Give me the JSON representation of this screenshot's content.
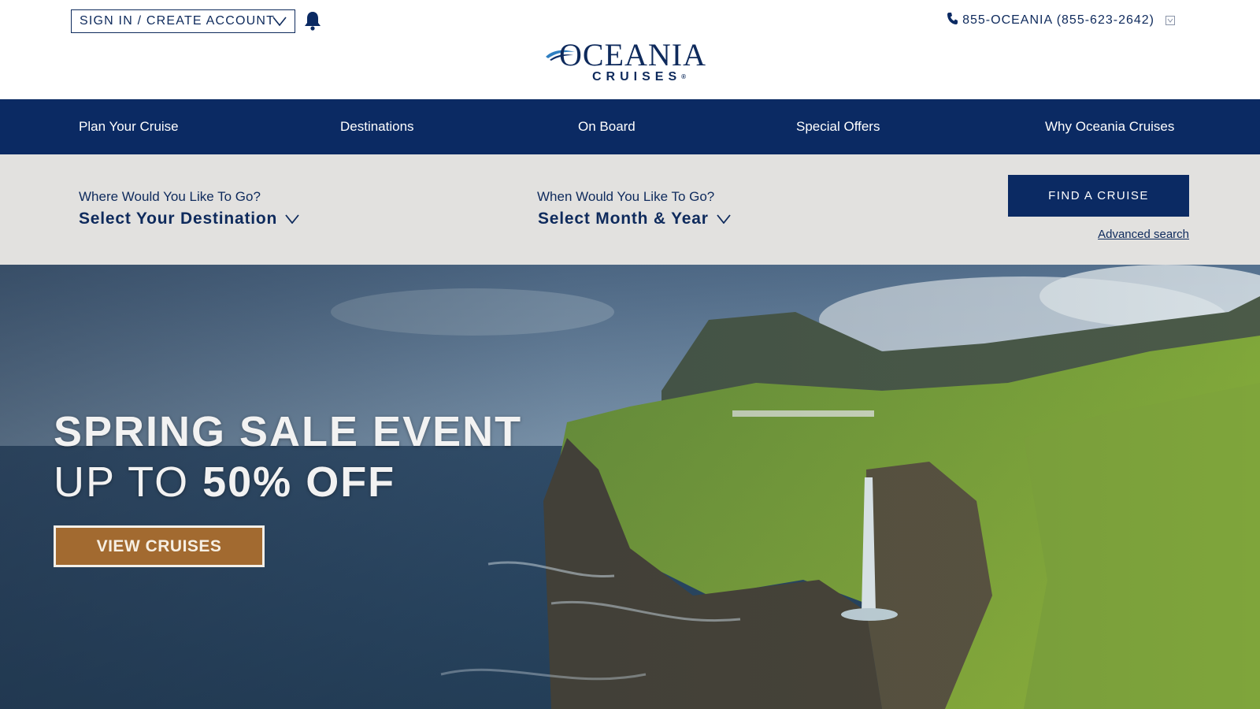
{
  "header": {
    "signin_label": "SIGN IN / CREATE ACCOUNT",
    "phone_label": "855-OCEANIA (855-623-2642)",
    "logo": {
      "name": "OCEANIA",
      "sub": "CRUISES",
      "mark": "®"
    }
  },
  "nav": {
    "items": [
      {
        "label": "Plan Your Cruise"
      },
      {
        "label": "Destinations"
      },
      {
        "label": "On Board"
      },
      {
        "label": "Special Offers"
      },
      {
        "label": "Why Oceania Cruises"
      }
    ]
  },
  "search": {
    "destination_label": "Where Would You Like To Go?",
    "destination_value": "Select Your Destination",
    "date_label": "When Would You Like To Go?",
    "date_value": "Select Month & Year",
    "find_button": "FIND A CRUISE",
    "advanced_link": "Advanced search"
  },
  "hero": {
    "line1": "SPRING SALE EVENT",
    "line2_prefix": "UP TO",
    "line2_bold": "50% OFF",
    "cta": "VIEW CRUISES"
  },
  "colors": {
    "brand_navy": "#0b2a63",
    "search_bg": "#e2e1df",
    "cta_bronze": "#a26a30"
  },
  "icons": [
    "chevron-down-icon",
    "bell-icon",
    "phone-icon",
    "logo-swoosh-icon"
  ]
}
